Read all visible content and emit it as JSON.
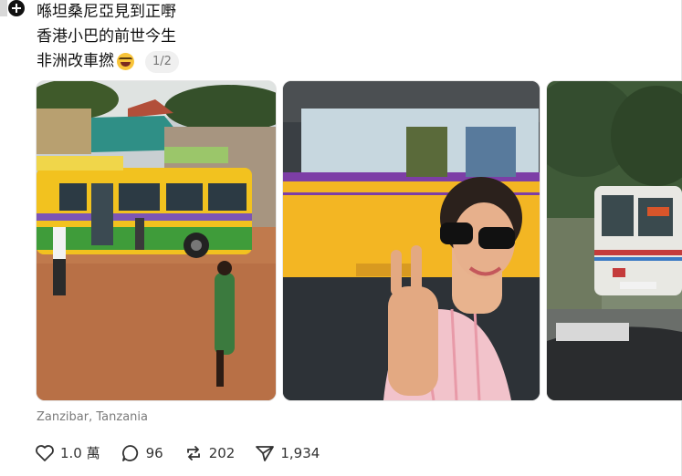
{
  "post": {
    "lines": [
      "喺坦桑尼亞見到正嘢",
      "香港小巴的前世今生",
      "非洲改車撚"
    ],
    "pager": "1/2",
    "location": "Zanzibar, Tanzania"
  },
  "actions": {
    "likes": "1.0 萬",
    "comments": "96",
    "reposts": "202",
    "shares": "1,934"
  },
  "photos": [
    {
      "subject": "green-yellow-bus-on-dirt-road"
    },
    {
      "subject": "woman-peace-sign-in-car-with-yellow-purple-bus"
    },
    {
      "subject": "white-minibus-rear-on-road"
    }
  ],
  "icons": [
    "plus-icon",
    "heart-icon",
    "comment-icon",
    "repost-icon",
    "share-icon"
  ],
  "colors": {
    "text": "#111111",
    "muted": "#7a7a7a",
    "pill": "#f0f0f0"
  }
}
